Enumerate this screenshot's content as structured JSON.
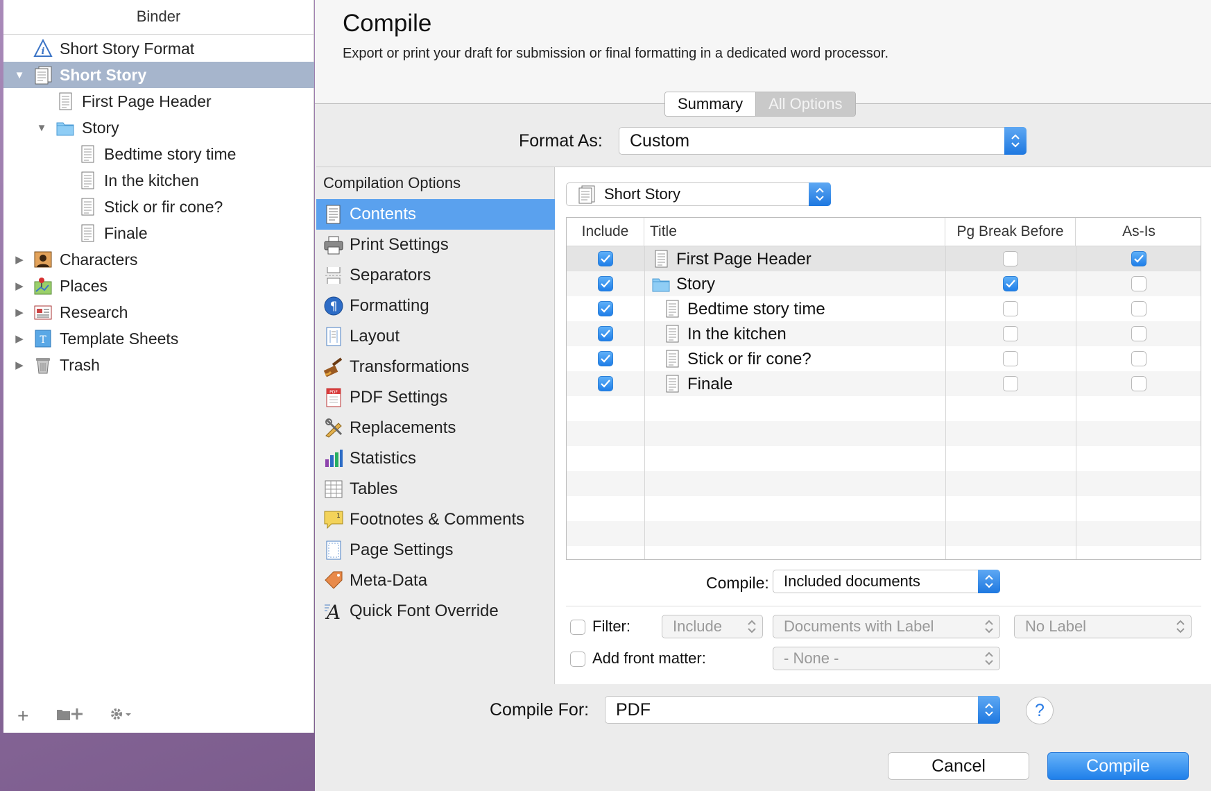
{
  "binder": {
    "title": "Binder",
    "items": [
      {
        "label": "Short Story Format",
        "icon": "info-icon"
      },
      {
        "label": "Short Story",
        "icon": "draft-icon"
      },
      {
        "label": "First Page Header",
        "icon": "document-icon"
      },
      {
        "label": "Story",
        "icon": "folder-icon"
      },
      {
        "label": "Bedtime story time",
        "icon": "document-icon"
      },
      {
        "label": "In the kitchen",
        "icon": "document-icon"
      },
      {
        "label": "Stick or fir cone?",
        "icon": "document-icon"
      },
      {
        "label": "Finale",
        "icon": "document-icon"
      },
      {
        "label": "Characters",
        "icon": "characters-icon"
      },
      {
        "label": "Places",
        "icon": "places-icon"
      },
      {
        "label": "Research",
        "icon": "research-icon"
      },
      {
        "label": "Template Sheets",
        "icon": "template-icon"
      },
      {
        "label": "Trash",
        "icon": "trash-icon"
      }
    ],
    "footer": {
      "add": "+",
      "add_folder": "+",
      "gear": "⚙▾"
    }
  },
  "dialog": {
    "title": "Compile",
    "subtitle": "Export or print your draft for submission or final formatting in a dedicated word processor.",
    "tabs": [
      "Summary",
      "All Options"
    ],
    "format_as_label": "Format As:",
    "format_as_value": "Custom",
    "options_heading": "Compilation Options",
    "options": [
      "Contents",
      "Print Settings",
      "Separators",
      "Formatting",
      "Layout",
      "Transformations",
      "PDF Settings",
      "Replacements",
      "Statistics",
      "Tables",
      "Footnotes & Comments",
      "Page Settings",
      "Meta-Data",
      "Quick Font Override"
    ],
    "root_select": "Short Story",
    "table": {
      "headers": [
        "Include",
        "Title",
        "Pg Break Before",
        "As-Is"
      ],
      "rows": [
        {
          "include": true,
          "title": "First Page Header",
          "icon": "document-icon",
          "pgbreak": false,
          "asis": true
        },
        {
          "include": true,
          "title": "Story",
          "icon": "folder-icon",
          "pgbreak": true,
          "asis": false
        },
        {
          "include": true,
          "title": "Bedtime story time",
          "icon": "document-icon",
          "pgbreak": false,
          "asis": false
        },
        {
          "include": true,
          "title": "In the kitchen",
          "icon": "document-icon",
          "pgbreak": false,
          "asis": false
        },
        {
          "include": true,
          "title": "Stick or fir cone?",
          "icon": "document-icon",
          "pgbreak": false,
          "asis": false
        },
        {
          "include": true,
          "title": "Finale",
          "icon": "document-icon",
          "pgbreak": false,
          "asis": false
        }
      ]
    },
    "compile_label": "Compile:",
    "compile_value": "Included documents",
    "filter_label": "Filter:",
    "filter_mode": "Include",
    "filter_type": "Documents with Label",
    "filter_value": "No Label",
    "front_matter_label": "Add front matter:",
    "front_matter_value": "- None -",
    "compile_for_label": "Compile For:",
    "compile_for_value": "PDF",
    "help": "?",
    "cancel": "Cancel",
    "compile": "Compile"
  }
}
